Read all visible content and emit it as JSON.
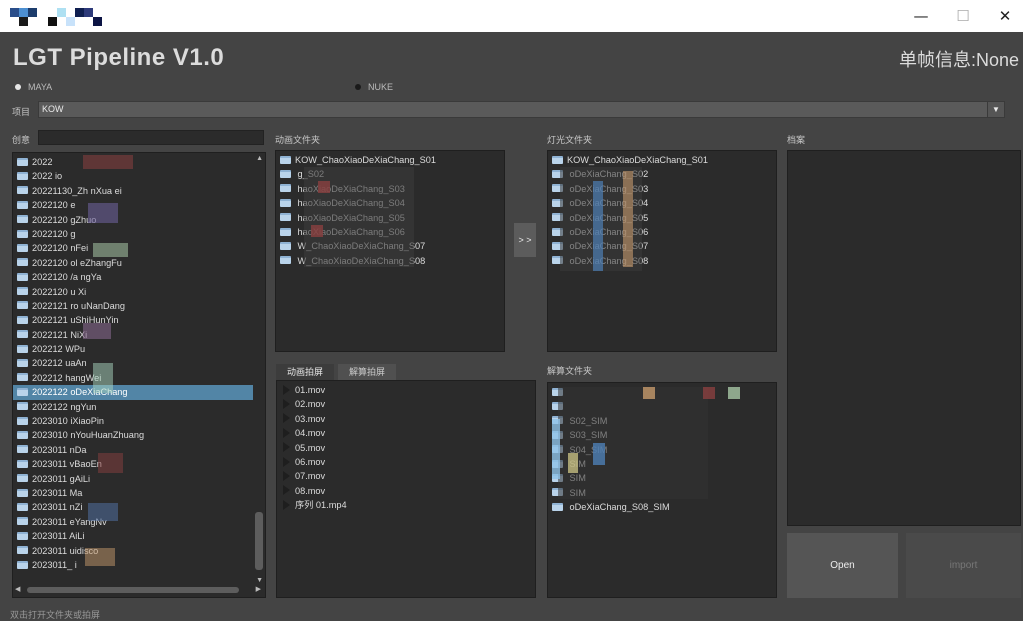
{
  "window": {
    "minimize": "—",
    "maximize": "☐",
    "close": "✕"
  },
  "app": {
    "title": "LGT Pipeline V1.0",
    "frame_info": "单帧信息:None"
  },
  "software": {
    "options": [
      "MAYA",
      "NUKE"
    ],
    "selected": "MAYA"
  },
  "project": {
    "label": "项目",
    "value": "KOW"
  },
  "create": {
    "label": "创意",
    "search_value": ""
  },
  "left_tree": {
    "rows": [
      "2022",
      "2022           io",
      "20221130_Zh     nXua     ei",
      "2022120           e",
      "2022120          gZhuo",
      "2022120          g",
      "2022120        nFei",
      "2022120  ol     eZhangFu",
      "2022120  /a    ngYa",
      "2022120    u   Xi",
      "2022121  ro    uNanDang",
      "2022121        uShiHunYin",
      "2022121         NiXi",
      "202212         WPu",
      "202212         uaAn",
      "202212        hangWei",
      "2022122        oDeXiaChang",
      "2022122        ngYun",
      "2023010        iXiaoPin",
      "2023010       nYouHuanZhuang",
      "2023011        nDa",
      "2023011       vBaoEn",
      "2023011       gAiLi",
      "2023011        Ma",
      "2023011        nZi",
      "2023011       eYangNv",
      "2023011        AiLi",
      "2023011       uidisco",
      "2023011_       i"
    ],
    "selected_index": 16
  },
  "anim_folder": {
    "label": "动画文件夹",
    "items": [
      "KOW_ChaoXiaoDeXiaChang_S01",
      "                   g_S02",
      "        haoXiaoDeXiaChang_S03",
      "        haoXiaoDeXiaChang_S04",
      "        haoXiaoDeXiaChang_S05",
      "        haoXiaoDeXiaChang_S06",
      "   W_ChaoXiaoDeXiaChang_S07",
      "   W_ChaoXiaoDeXiaChang_S08"
    ]
  },
  "transfer_button": "> >",
  "light_folder": {
    "label": "灯光文件夹",
    "items": [
      "KOW_ChaoXiaoDeXiaChang_S01",
      "               oDeXiaChang_S02",
      "               oDeXiaChang_S03",
      "               oDeXiaChang_S04",
      "               oDeXiaChang_S05",
      "               oDeXiaChang_S06",
      "               oDeXiaChang_S07",
      "               oDeXiaChang_S08"
    ]
  },
  "archive": {
    "label": "档案"
  },
  "tabs": {
    "anim_playblast": "动画拍屏",
    "solve_playblast": "解算拍屏",
    "active": "anim_playblast"
  },
  "movs": [
    "01.mov",
    "02.mov",
    "03.mov",
    "04.mov",
    "05.mov",
    "06.mov",
    "07.mov",
    "08.mov",
    "序列 01.mp4"
  ],
  "sim_folder": {
    "label": "解算文件夹",
    "items": [
      "",
      "",
      "              S02_SIM",
      "              S03_SIM",
      "              S04_SIM",
      "               SIM",
      "               SIM",
      "               SIM",
      "               oDeXiaChang_S08_SIM"
    ]
  },
  "buttons": {
    "open": "Open",
    "import": "import"
  },
  "status": {
    "hint": "双击打开文件夹或拍屏"
  },
  "colors": {
    "background": "#444444",
    "panel": "#2b2b2b",
    "selection": "#5285a6",
    "text": "#dcdcdc"
  }
}
